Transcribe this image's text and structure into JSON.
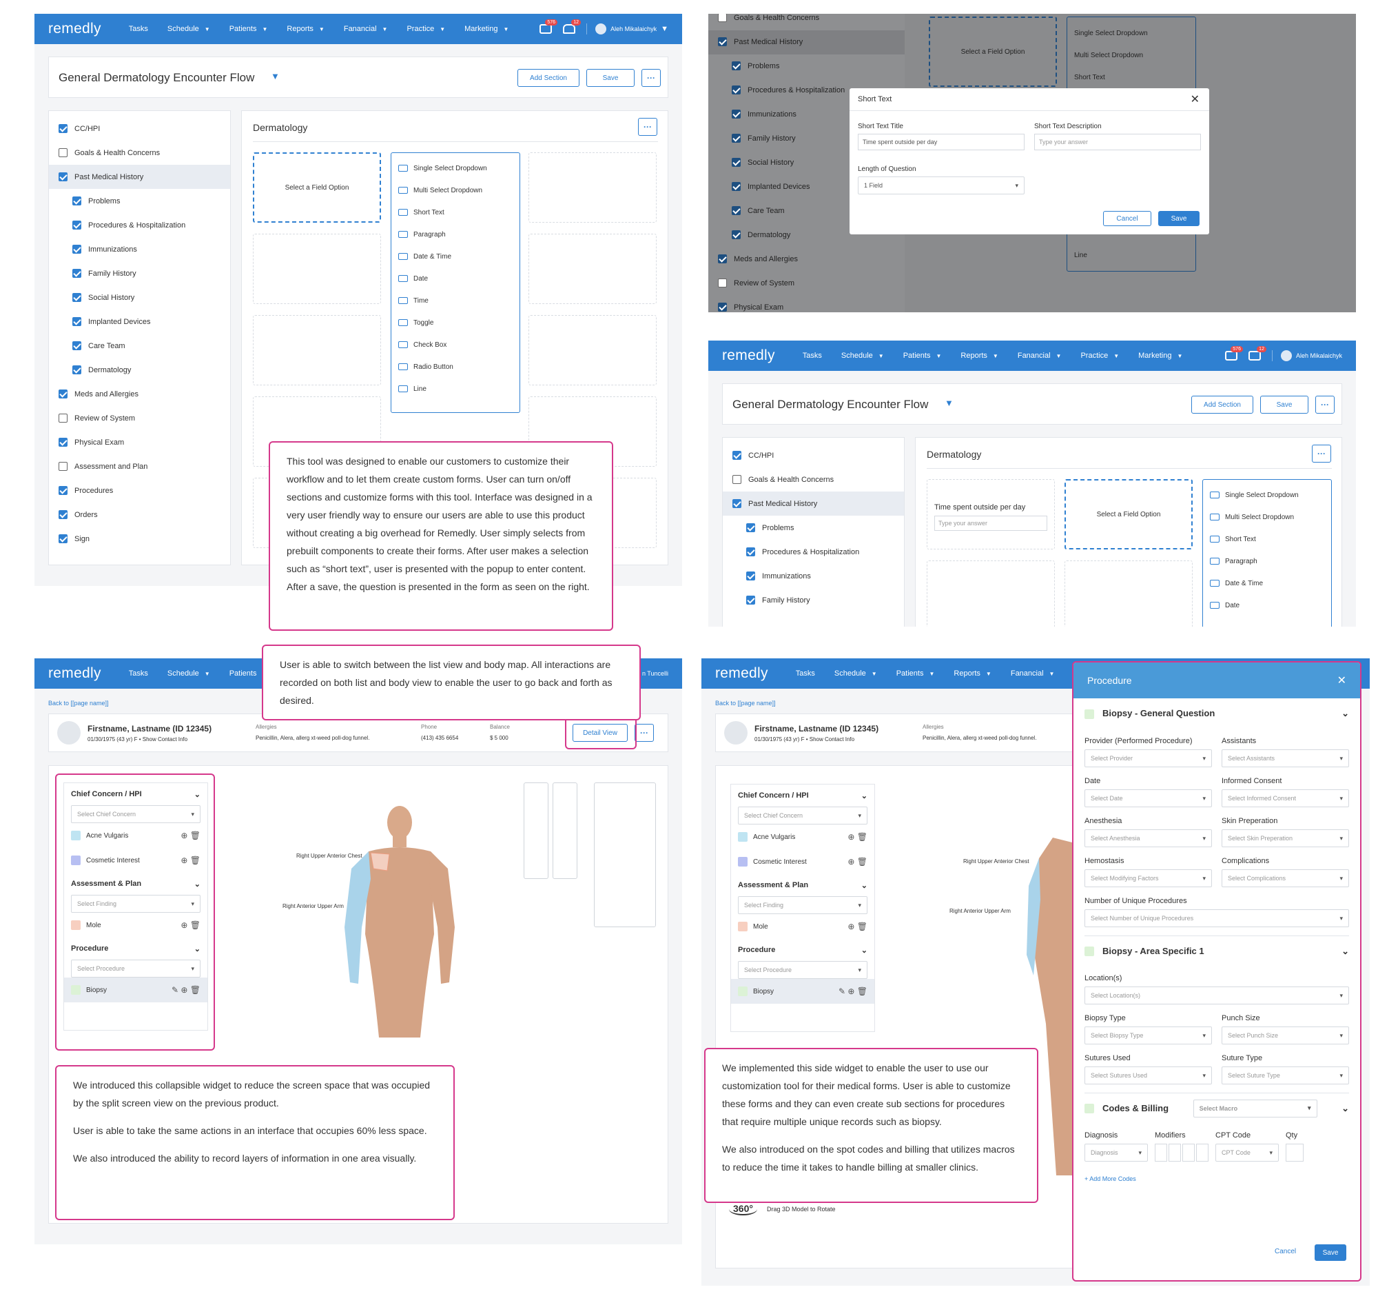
{
  "nav": {
    "logo": "remedly",
    "items": [
      "Tasks",
      "Schedule",
      "Patients",
      "Reports",
      "Fanancial",
      "Practice",
      "Marketing"
    ],
    "user": "Aleh Mikalaichyk",
    "badge1": "576",
    "badge2": "12"
  },
  "builder": {
    "title": "General Dermatology Encounter Flow",
    "add_section": "Add Section",
    "save": "Save",
    "section_heading": "Dermatology",
    "select_field": "Select a Field Option",
    "sections": [
      {
        "label": "CC/HPI",
        "checked": true,
        "sub": false,
        "sel": false
      },
      {
        "label": "Goals & Health Concerns",
        "checked": false,
        "sub": false,
        "sel": false
      },
      {
        "label": "Past Medical History",
        "checked": true,
        "sub": false,
        "sel": true
      },
      {
        "label": "Problems",
        "checked": true,
        "sub": true,
        "sel": false
      },
      {
        "label": "Procedures & Hospitalization",
        "checked": true,
        "sub": true,
        "sel": false
      },
      {
        "label": "Immunizations",
        "checked": true,
        "sub": true,
        "sel": false
      },
      {
        "label": "Family History",
        "checked": true,
        "sub": true,
        "sel": false
      },
      {
        "label": "Social History",
        "checked": true,
        "sub": true,
        "sel": false
      },
      {
        "label": "Implanted Devices",
        "checked": true,
        "sub": true,
        "sel": false
      },
      {
        "label": "Care Team",
        "checked": true,
        "sub": true,
        "sel": false
      },
      {
        "label": "Dermatology",
        "checked": true,
        "sub": true,
        "sel": false
      },
      {
        "label": "Meds and Allergies",
        "checked": true,
        "sub": false,
        "sel": false
      },
      {
        "label": "Review of System",
        "checked": false,
        "sub": false,
        "sel": false
      },
      {
        "label": "Physical Exam",
        "checked": true,
        "sub": false,
        "sel": false
      },
      {
        "label": "Assessment and Plan",
        "checked": false,
        "sub": false,
        "sel": false
      },
      {
        "label": "Procedures",
        "checked": true,
        "sub": false,
        "sel": false
      },
      {
        "label": "Orders",
        "checked": true,
        "sub": false,
        "sel": false
      },
      {
        "label": "Sign",
        "checked": true,
        "sub": false,
        "sel": false
      }
    ],
    "field_options": [
      "Single Select Dropdown",
      "Multi Select Dropdown",
      "Short Text",
      "Paragraph",
      "Date & Time",
      "Date",
      "Time",
      "Toggle",
      "Check Box",
      "Radio Button",
      "Line"
    ]
  },
  "modal": {
    "title": "Short Text",
    "title_label": "Short Text Title",
    "title_value": "Time spent outside per day",
    "desc_label": "Short Text Description",
    "desc_placeholder": "Type your answer",
    "length_label": "Length of Question",
    "length_value": "1 Field",
    "cancel": "Cancel",
    "save": "Save",
    "line": "Line"
  },
  "preview": {
    "question": "Time spent outside per day",
    "placeholder": "Type your answer"
  },
  "patient": {
    "back": "Back to [[page name]]",
    "name": "Firstname, Lastname (ID 12345)",
    "info": "01/30/1975 (43 yr) F  •  Show Contact Info",
    "allergies_label": "Allergies",
    "allergies": "Penicillin, Alera, allerg xt-weed poll-dog funnel.",
    "phone_label": "Phone",
    "phone": "(413) 435 6654",
    "balance_label": "Balance",
    "balance": "$ 5 000",
    "detail_view": "Detail View",
    "tuncelli": "n Tuncelli"
  },
  "widget": {
    "cc_title": "Chief Concern / HPI",
    "cc_select": "Select Chief Concern",
    "cc_items": [
      "Acne Vulgaris",
      "Cosmetic Interest"
    ],
    "ap_title": "Assessment & Plan",
    "ap_select": "Select Finding",
    "ap_items": [
      "Mole"
    ],
    "proc_title": "Procedure",
    "proc_select": "Select Procedure",
    "proc_items": [
      "Biopsy"
    ]
  },
  "body_labels": {
    "upper_chest": "Right Upper Anterior Chest",
    "upper_arm": "Right Anterior Upper Arm"
  },
  "rotate": {
    "badge": "360°",
    "text": "Drag 3D Model to Rotate"
  },
  "notes": {
    "n1": "This tool was designed to enable our customers to customize their workflow and to let them create custom forms. User can turn on/off sections and customize forms with this tool. Interface was designed in a very user friendly way to ensure our users are able to use this product without creating a big overhead for Remedly. User simply selects from prebuilt components to create their forms.  After user makes a selection such as “short text”, user is presented with the popup to enter content. After a save, the question is presented in the form as seen on the right.",
    "n2": "User is able to switch between the list view and body map. All interactions are recorded on both list and body view to enable the user to go back and forth as desired.",
    "n3a": "We introduced this collapsible widget to reduce the screen space that was occupied by the split screen view on the previous product.",
    "n3b": "User is able to take the same actions in an interface that occupies 60% less space.",
    "n3c": "We also introduced the ability to record layers of information in one area visually.",
    "n4a": "We implemented this side widget to enable the user to use our customization tool for their medical forms. User is able to customize these forms and they can even create sub sections for procedures that require multiple unique  records such as biopsy.",
    "n4b": "We also introduced on the spot codes and billing that utilizes macros to reduce the time it takes to handle billing at smaller clinics."
  },
  "procedure": {
    "title": "Procedure",
    "g1": "Biopsy - General Question",
    "provider_l": "Provider (Performed Procedure)",
    "provider_p": "Select Provider",
    "assist_l": "Assistants",
    "assist_p": "Select Assistants",
    "date_l": "Date",
    "date_p": "Select Date",
    "consent_l": "Informed Consent",
    "consent_p": "Select Informed Consent",
    "anes_l": "Anesthesia",
    "anes_p": "Select Anesthesia",
    "skin_l": "Skin Preperation",
    "skin_p": "Select Skin Preperation",
    "hemo_l": "Hemostasis",
    "hemo_p": "Select Modifying Factors",
    "comp_l": "Complications",
    "comp_p": "Select Complications",
    "num_l": "Number of Unique Procedures",
    "num_p": "Select Number of Unique Procedures",
    "g2": "Biopsy  - Area Specific 1",
    "loc_l": "Location(s)",
    "loc_p": "Select Location(s)",
    "btype_l": "Biopsy Type",
    "btype_p": "Select Biopsy Type",
    "punch_l": "Punch Size",
    "punch_p": "Select Punch Size",
    "sut_l": "Sutures Used",
    "sut_p": "Select Sutures Used",
    "stype_l": "Suture Type",
    "stype_p": "Select Suture Type",
    "g3": "Codes & Billing",
    "macro_p": "Select Macro",
    "diag_l": "Diagnosis",
    "diag_p": "Diagnosis",
    "mod_l": "Modifiers",
    "cpt_l": "CPT Code",
    "cpt_p": "CPT Code",
    "qty_l": "Qty",
    "add_more": "+ Add More Codes",
    "cancel": "Cancel",
    "save": "Save"
  },
  "colors": {
    "brand": "#2f80d1",
    "accent": "#d5388b",
    "acne": "#bfe4f2",
    "cosmetic": "#b7bff2",
    "mole": "#f7cfc0",
    "biopsy": "#dcf2d6"
  }
}
